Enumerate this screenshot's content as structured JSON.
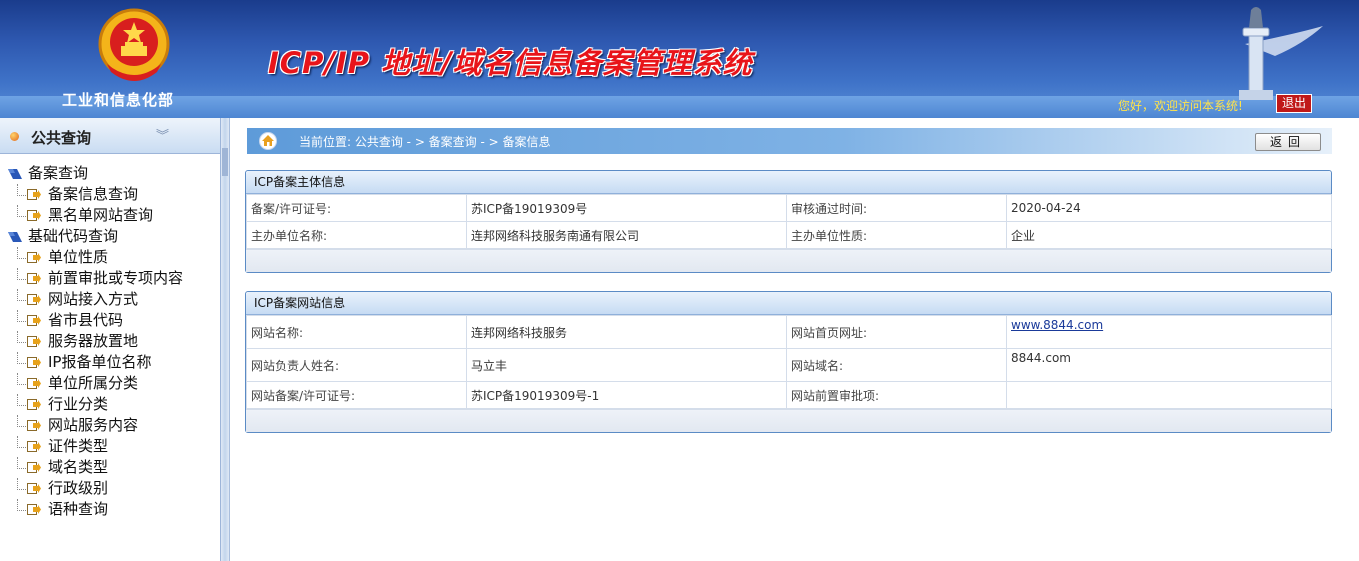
{
  "header": {
    "ministry": "工业和信息化部",
    "title": "ICP/IP 地址/域名信息备案管理系统",
    "welcome": "您好，欢迎访问本系统!",
    "logout": "退出"
  },
  "sidebar": {
    "section_title": "公共查询",
    "groups": [
      {
        "label": "备案查询",
        "items": [
          "备案信息查询",
          "黑名单网站查询"
        ]
      },
      {
        "label": "基础代码查询",
        "items": [
          "单位性质",
          "前置审批或专项内容",
          "网站接入方式",
          "省市县代码",
          "服务器放置地",
          "IP报备单位名称",
          "单位所属分类",
          "行业分类",
          "网站服务内容",
          "证件类型",
          "域名类型",
          "行政级别",
          "语种查询"
        ]
      }
    ]
  },
  "breadcrumb": {
    "text": "当前位置: 公共查询  - >  备案查询  - >  备案信息",
    "back": "返回"
  },
  "subject": {
    "title": "ICP备案主体信息",
    "rows": [
      {
        "l1": "备案/许可证号:",
        "v1": "苏ICP备19019309号",
        "l2": "审核通过时间:",
        "v2": "2020-04-24"
      },
      {
        "l1": "主办单位名称:",
        "v1": "连邦网络科技服务南通有限公司",
        "l2": "主办单位性质:",
        "v2": "企业"
      }
    ]
  },
  "website": {
    "title": "ICP备案网站信息",
    "rows": [
      {
        "l1": "网站名称:",
        "v1": "连邦网络科技服务",
        "l2": "网站首页网址:",
        "v2": "www.8844.com"
      },
      {
        "l1": "网站负责人姓名:",
        "v1": "马立丰",
        "l2": "网站域名:",
        "v2": "8844.com"
      },
      {
        "l1": "网站备案/许可证号:",
        "v1": "苏ICP备19019309号-1",
        "l2": "网站前置审批项:",
        "v2": ""
      }
    ]
  },
  "colors": {
    "header_blue": "#2e58b0",
    "title_red": "#e8141a",
    "welcome_yellow": "#ffe34a",
    "link": "#1a3a9a"
  }
}
